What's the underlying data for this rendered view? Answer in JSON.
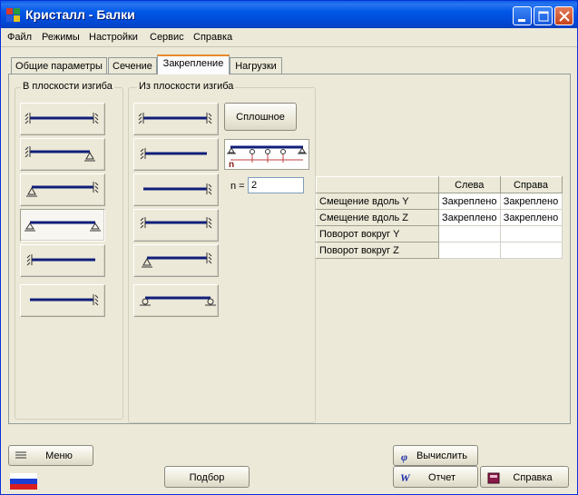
{
  "window": {
    "title": "Кристалл - Балки"
  },
  "menu": [
    "Файл",
    "Режимы",
    "Настройки",
    "Сервис",
    "Справка"
  ],
  "tabs": [
    {
      "label": "Общие параметры",
      "active": false
    },
    {
      "label": "Сечение",
      "active": false
    },
    {
      "label": "Закрепление",
      "active": true
    },
    {
      "label": "Нагрузки",
      "active": false
    }
  ],
  "in_plane": {
    "title": "В плоскости изгиба",
    "selected_index": 3
  },
  "out_plane": {
    "title": "Из плоскости изгиба",
    "continuous_button": "Сплошное",
    "n_label": "n =",
    "n_value": "2"
  },
  "restraints_table": {
    "columns": [
      "",
      "Слева",
      "Справа"
    ],
    "rows": [
      {
        "label": "Смещение вдоль Y",
        "left": "Закреплено",
        "right": "Закреплено"
      },
      {
        "label": "Смещение вдоль Z",
        "left": "Закреплено",
        "right": "Закреплено"
      },
      {
        "label": "Поворот вокруг Y",
        "left": "",
        "right": ""
      },
      {
        "label": "Поворот вокруг Z",
        "left": "",
        "right": ""
      }
    ]
  },
  "footer": {
    "menu_button": "Меню",
    "select_button": "Подбор",
    "calculate_button": "Вычислить",
    "report_button": "Отчет",
    "help_button": "Справка"
  },
  "colors": {
    "beam": "#0f1f7a",
    "title_bar": "#0058e6",
    "tab_highlight": "#e68b2c",
    "dialog_bg": "#ece9d8"
  }
}
